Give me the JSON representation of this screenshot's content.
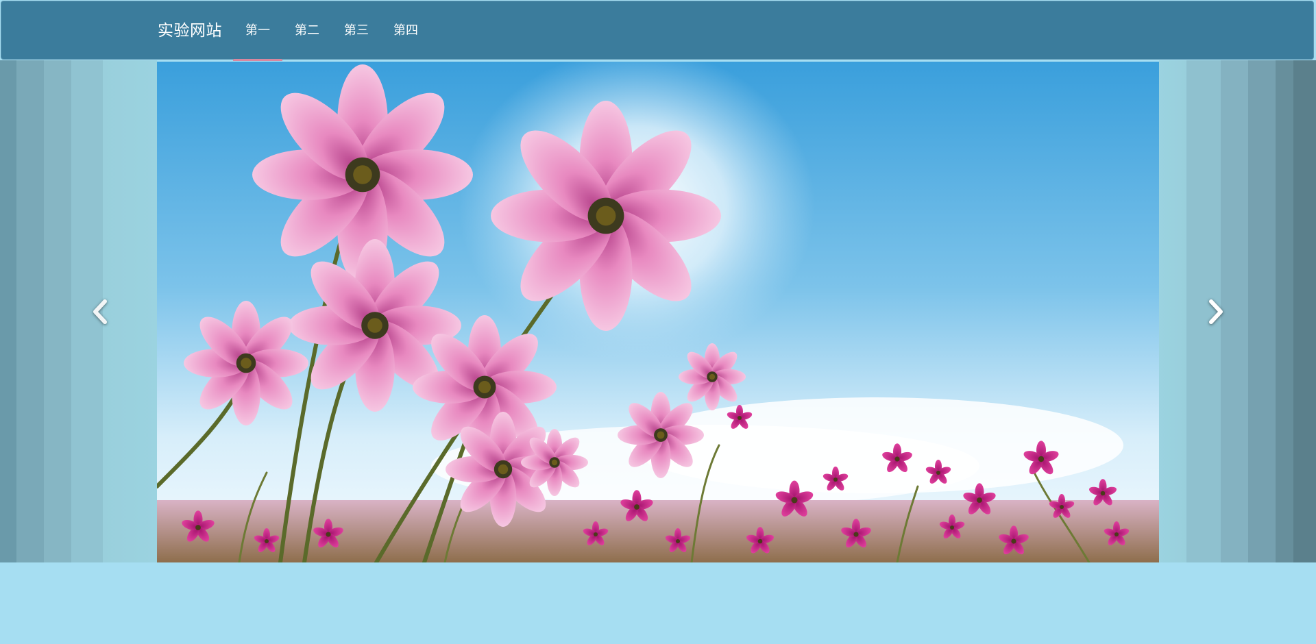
{
  "navbar": {
    "brand": "实验网站",
    "items": [
      {
        "label": "第一",
        "active": true
      },
      {
        "label": "第二",
        "active": false
      },
      {
        "label": "第三",
        "active": false
      },
      {
        "label": "第四",
        "active": false
      }
    ]
  },
  "carousel": {
    "active_slide": "cosmos-flower-field",
    "prev_icon": "chevron-left-icon",
    "next_icon": "chevron-right-icon"
  },
  "colors": {
    "navbar": "#3b7c9c",
    "page_background": "#a6def2",
    "active_indicator": "#d9879e"
  }
}
